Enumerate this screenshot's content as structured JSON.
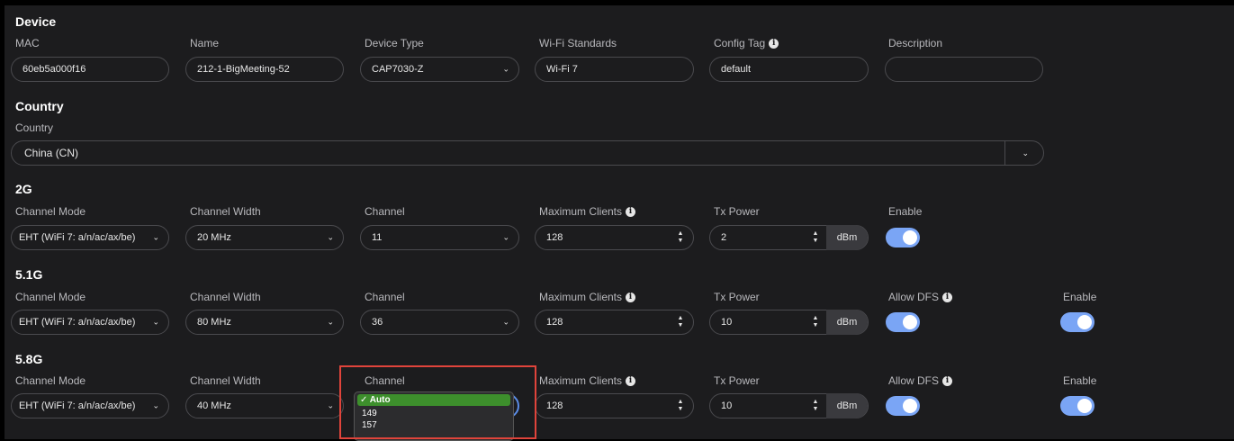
{
  "sections": {
    "device": "Device",
    "country": "Country",
    "g2": "2G",
    "g51": "5.1G",
    "g58": "5.8G"
  },
  "labels": {
    "mac": "MAC",
    "name": "Name",
    "device_type": "Device Type",
    "wifi_standards": "Wi-Fi Standards",
    "config_tag": "Config Tag",
    "description": "Description",
    "country": "Country",
    "channel_mode": "Channel Mode",
    "channel_width": "Channel Width",
    "channel": "Channel",
    "max_clients": "Maximum Clients",
    "tx_power": "Tx Power",
    "enable": "Enable",
    "allow_dfs": "Allow DFS"
  },
  "device": {
    "mac": "60eb5a000f16",
    "name": "212-1-BigMeeting-52",
    "device_type": "CAP7030-Z",
    "wifi_standards": "Wi-Fi 7",
    "config_tag": "default",
    "description": ""
  },
  "country": {
    "value": "China (CN)"
  },
  "g2": {
    "channel_mode": "EHT (WiFi 7: a/n/ac/ax/be)",
    "channel_width": "20 MHz",
    "channel": "11",
    "max_clients": "128",
    "tx_power": "2",
    "tx_unit": "dBm",
    "enable": true
  },
  "g51": {
    "channel_mode": "EHT (WiFi 7: a/n/ac/ax/be)",
    "channel_width": "80 MHz",
    "channel": "36",
    "max_clients": "128",
    "tx_power": "10",
    "tx_unit": "dBm",
    "allow_dfs": true,
    "enable": true
  },
  "g58": {
    "channel_mode": "EHT (WiFi 7: a/n/ac/ax/be)",
    "channel_width": "40 MHz",
    "max_clients": "128",
    "tx_power": "10",
    "tx_unit": "dBm",
    "allow_dfs": true,
    "enable": true,
    "channel_options": [
      "✓ Auto",
      "149",
      "157"
    ]
  },
  "icons": {
    "info": "i",
    "chevron": "⌄"
  },
  "colors": {
    "toggle_on": "#7aa5f5",
    "selected_option": "#3d8f2c",
    "highlight": "#e0443b"
  }
}
